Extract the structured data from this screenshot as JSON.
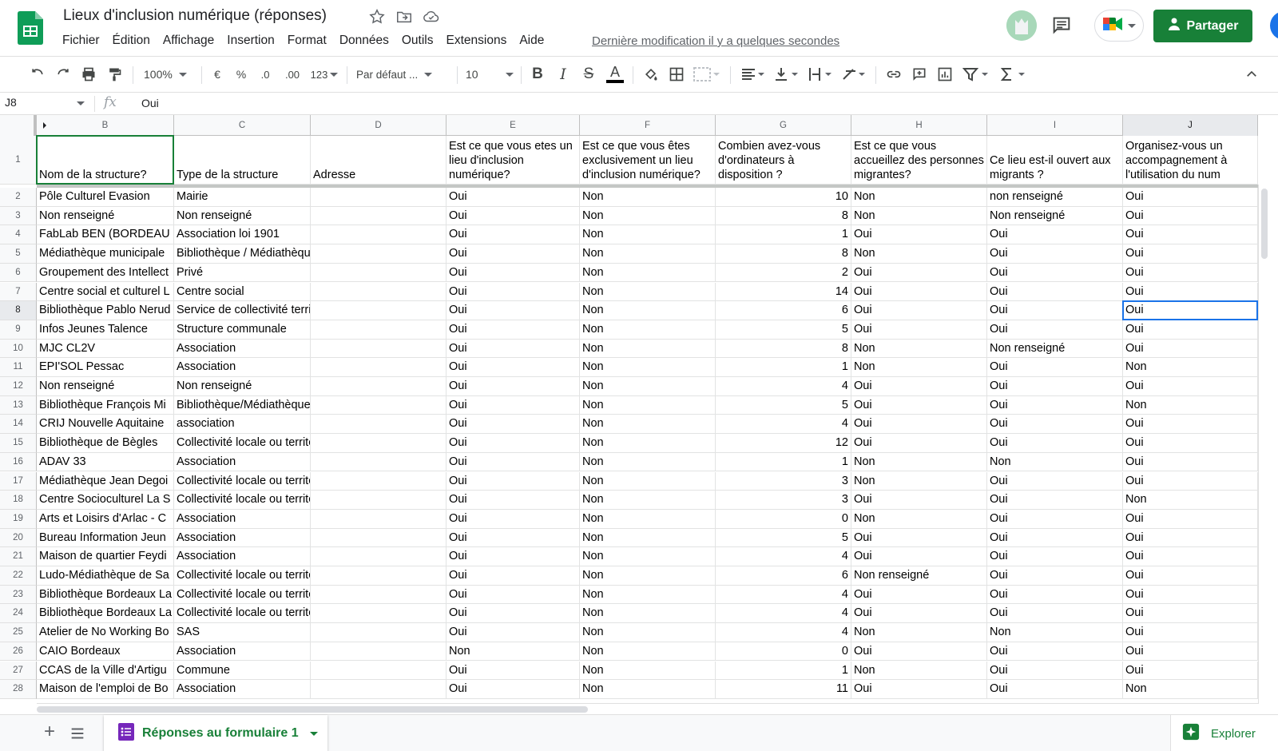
{
  "header": {
    "doc_title": "Lieux d'inclusion numérique (réponses)",
    "menus": [
      "Fichier",
      "Édition",
      "Affichage",
      "Insertion",
      "Format",
      "Données",
      "Outils",
      "Extensions",
      "Aide"
    ],
    "last_edit": "Dernière modification il y a quelques secondes",
    "share_label": "Partager",
    "brand_color": "#188038"
  },
  "toolbar": {
    "zoom": "100%",
    "currency": "€",
    "percent": "%",
    "dec_decrease": ".0",
    "dec_increase": ".00",
    "more_formats": "123",
    "font": "Par défaut ...",
    "font_size": "10"
  },
  "formula_bar": {
    "cell_ref": "J8",
    "fx": "fx",
    "value": "Oui"
  },
  "grid": {
    "column_letters": [
      "B",
      "C",
      "D",
      "E",
      "F",
      "G",
      "H",
      "I",
      "J"
    ],
    "header_row_number": "1",
    "headers": [
      "Nom de la structure?",
      "Type de la structure",
      "Adresse",
      "Est ce que vous etes un lieu d'inclusion numérique?",
      "Est ce que vous êtes exclusivement un lieu d'inclusion numérique?",
      "Combien avez-vous d'ordinateurs à disposition ?",
      "Est ce que vous accueillez des personnes migrantes?",
      "Ce lieu est-il ouvert aux migrants ?",
      "Organisez-vous un accompagnement à l'utilisation du num"
    ],
    "rows": [
      {
        "n": "2",
        "cells": [
          "Pôle Culturel Evasion",
          "Mairie",
          "",
          "Oui",
          "Non",
          "10",
          "Non",
          "non renseigné",
          "Oui"
        ]
      },
      {
        "n": "3",
        "cells": [
          "Non renseigné",
          "Non renseigné",
          "",
          "Oui",
          "Non",
          "8",
          "Non",
          "Non renseigné",
          "Oui"
        ]
      },
      {
        "n": "4",
        "cells": [
          "FabLab BEN (BORDEAU",
          "Association loi 1901",
          "",
          "Oui",
          "Non",
          "1",
          "Oui",
          "Oui",
          "Oui"
        ]
      },
      {
        "n": "5",
        "cells": [
          "Médiathèque municipale",
          "Bibliothèque / Médiathèque",
          "",
          "Oui",
          "Non",
          "8",
          "Non",
          "Oui",
          "Oui"
        ]
      },
      {
        "n": "6",
        "cells": [
          "Groupement des Intellect",
          "Privé",
          "",
          "Oui",
          "Non",
          "2",
          "Oui",
          "Oui",
          "Oui"
        ]
      },
      {
        "n": "7",
        "cells": [
          "Centre social et culturel L",
          "Centre social",
          "",
          "Oui",
          "Non",
          "14",
          "Oui",
          "Oui",
          "Oui"
        ]
      },
      {
        "n": "8",
        "cells": [
          "Bibliothèque Pablo Nerud",
          "Service de collectivité territoriale",
          "",
          "Oui",
          "Non",
          "6",
          "Oui",
          "Oui",
          "Oui"
        ]
      },
      {
        "n": "9",
        "cells": [
          "Infos Jeunes Talence",
          "Structure communale",
          "",
          "Oui",
          "Non",
          "5",
          "Oui",
          "Oui",
          "Oui"
        ]
      },
      {
        "n": "10",
        "cells": [
          "MJC CL2V",
          "Association",
          "",
          "Oui",
          "Non",
          "8",
          "Non",
          "Non renseigné",
          "Oui"
        ]
      },
      {
        "n": "11",
        "cells": [
          "EPI'SOL Pessac",
          "Association",
          "",
          "Oui",
          "Non",
          "1",
          "Non",
          "Oui",
          "Non"
        ]
      },
      {
        "n": "12",
        "cells": [
          "Non renseigné",
          "Non renseigné",
          "",
          "Oui",
          "Non",
          "4",
          "Oui",
          "Oui",
          "Oui"
        ]
      },
      {
        "n": "13",
        "cells": [
          "Bibliothèque François Mi",
          "Bibliothèque/Médiathèque",
          "",
          "Oui",
          "Non",
          "5",
          "Oui",
          "Oui",
          "Non"
        ]
      },
      {
        "n": "14",
        "cells": [
          "CRIJ Nouvelle Aquitaine",
          "association",
          "",
          "Oui",
          "Non",
          "4",
          "Oui",
          "Oui",
          "Oui"
        ]
      },
      {
        "n": "15",
        "cells": [
          "Bibliothèque de Bègles",
          "Collectivité locale ou territoriale",
          "",
          "Oui",
          "Non",
          "12",
          "Oui",
          "Oui",
          "Oui"
        ]
      },
      {
        "n": "16",
        "cells": [
          "ADAV 33",
          "Association",
          "",
          "Oui",
          "Non",
          "1",
          "Non",
          "Non",
          "Oui"
        ]
      },
      {
        "n": "17",
        "cells": [
          "Médiathèque Jean Degoi",
          "Collectivité locale ou territoriale",
          "",
          "Oui",
          "Non",
          "3",
          "Non",
          "Oui",
          "Oui"
        ]
      },
      {
        "n": "18",
        "cells": [
          "Centre Socioculturel La S",
          "Collectivité locale ou territoriale",
          "",
          "Oui",
          "Non",
          "3",
          "Oui",
          "Oui",
          "Non"
        ]
      },
      {
        "n": "19",
        "cells": [
          "Arts et Loisirs d'Arlac - C",
          "Association",
          "",
          "Oui",
          "Non",
          "0",
          "Non",
          "Oui",
          "Oui"
        ]
      },
      {
        "n": "20",
        "cells": [
          "Bureau Information Jeun",
          "Association",
          "",
          "Oui",
          "Non",
          "5",
          "Oui",
          "Oui",
          "Oui"
        ]
      },
      {
        "n": "21",
        "cells": [
          "Maison de quartier Feydi",
          "Association",
          "",
          "Oui",
          "Non",
          "4",
          "Oui",
          "Oui",
          "Oui"
        ]
      },
      {
        "n": "22",
        "cells": [
          "Ludo-Médiathèque de Sa",
          "Collectivité locale ou territoriale",
          "",
          "Oui",
          "Non",
          "6",
          "Non renseigné",
          "Oui",
          "Oui"
        ]
      },
      {
        "n": "23",
        "cells": [
          "Bibliothèque Bordeaux La",
          "Collectivité locale ou territoriale",
          "",
          "Oui",
          "Non",
          "4",
          "Oui",
          "Oui",
          "Oui"
        ]
      },
      {
        "n": "24",
        "cells": [
          "Bibliothèque Bordeaux La",
          "Collectivité locale ou territoriale",
          "",
          "Oui",
          "Non",
          "4",
          "Oui",
          "Oui",
          "Oui"
        ]
      },
      {
        "n": "25",
        "cells": [
          "Atelier de No Working Bo",
          "SAS",
          "",
          "Oui",
          "Non",
          "4",
          "Non",
          "Non",
          "Oui"
        ]
      },
      {
        "n": "26",
        "cells": [
          "CAIO Bordeaux",
          "Association",
          "",
          "Non",
          "Non",
          "0",
          "Oui",
          "Oui",
          "Oui"
        ]
      },
      {
        "n": "27",
        "cells": [
          "CCAS de la Ville d'Artigu",
          "Commune",
          "",
          "Oui",
          "Non",
          "1",
          "Non",
          "Oui",
          "Oui"
        ]
      },
      {
        "n": "28",
        "cells": [
          "Maison de l'emploi de Bo",
          "Association",
          "",
          "Oui",
          "Non",
          "11",
          "Oui",
          "Oui",
          "Non"
        ]
      }
    ]
  },
  "bottom": {
    "sheet_tab": "Réponses au formulaire 1",
    "explore_label": "Explorer"
  }
}
